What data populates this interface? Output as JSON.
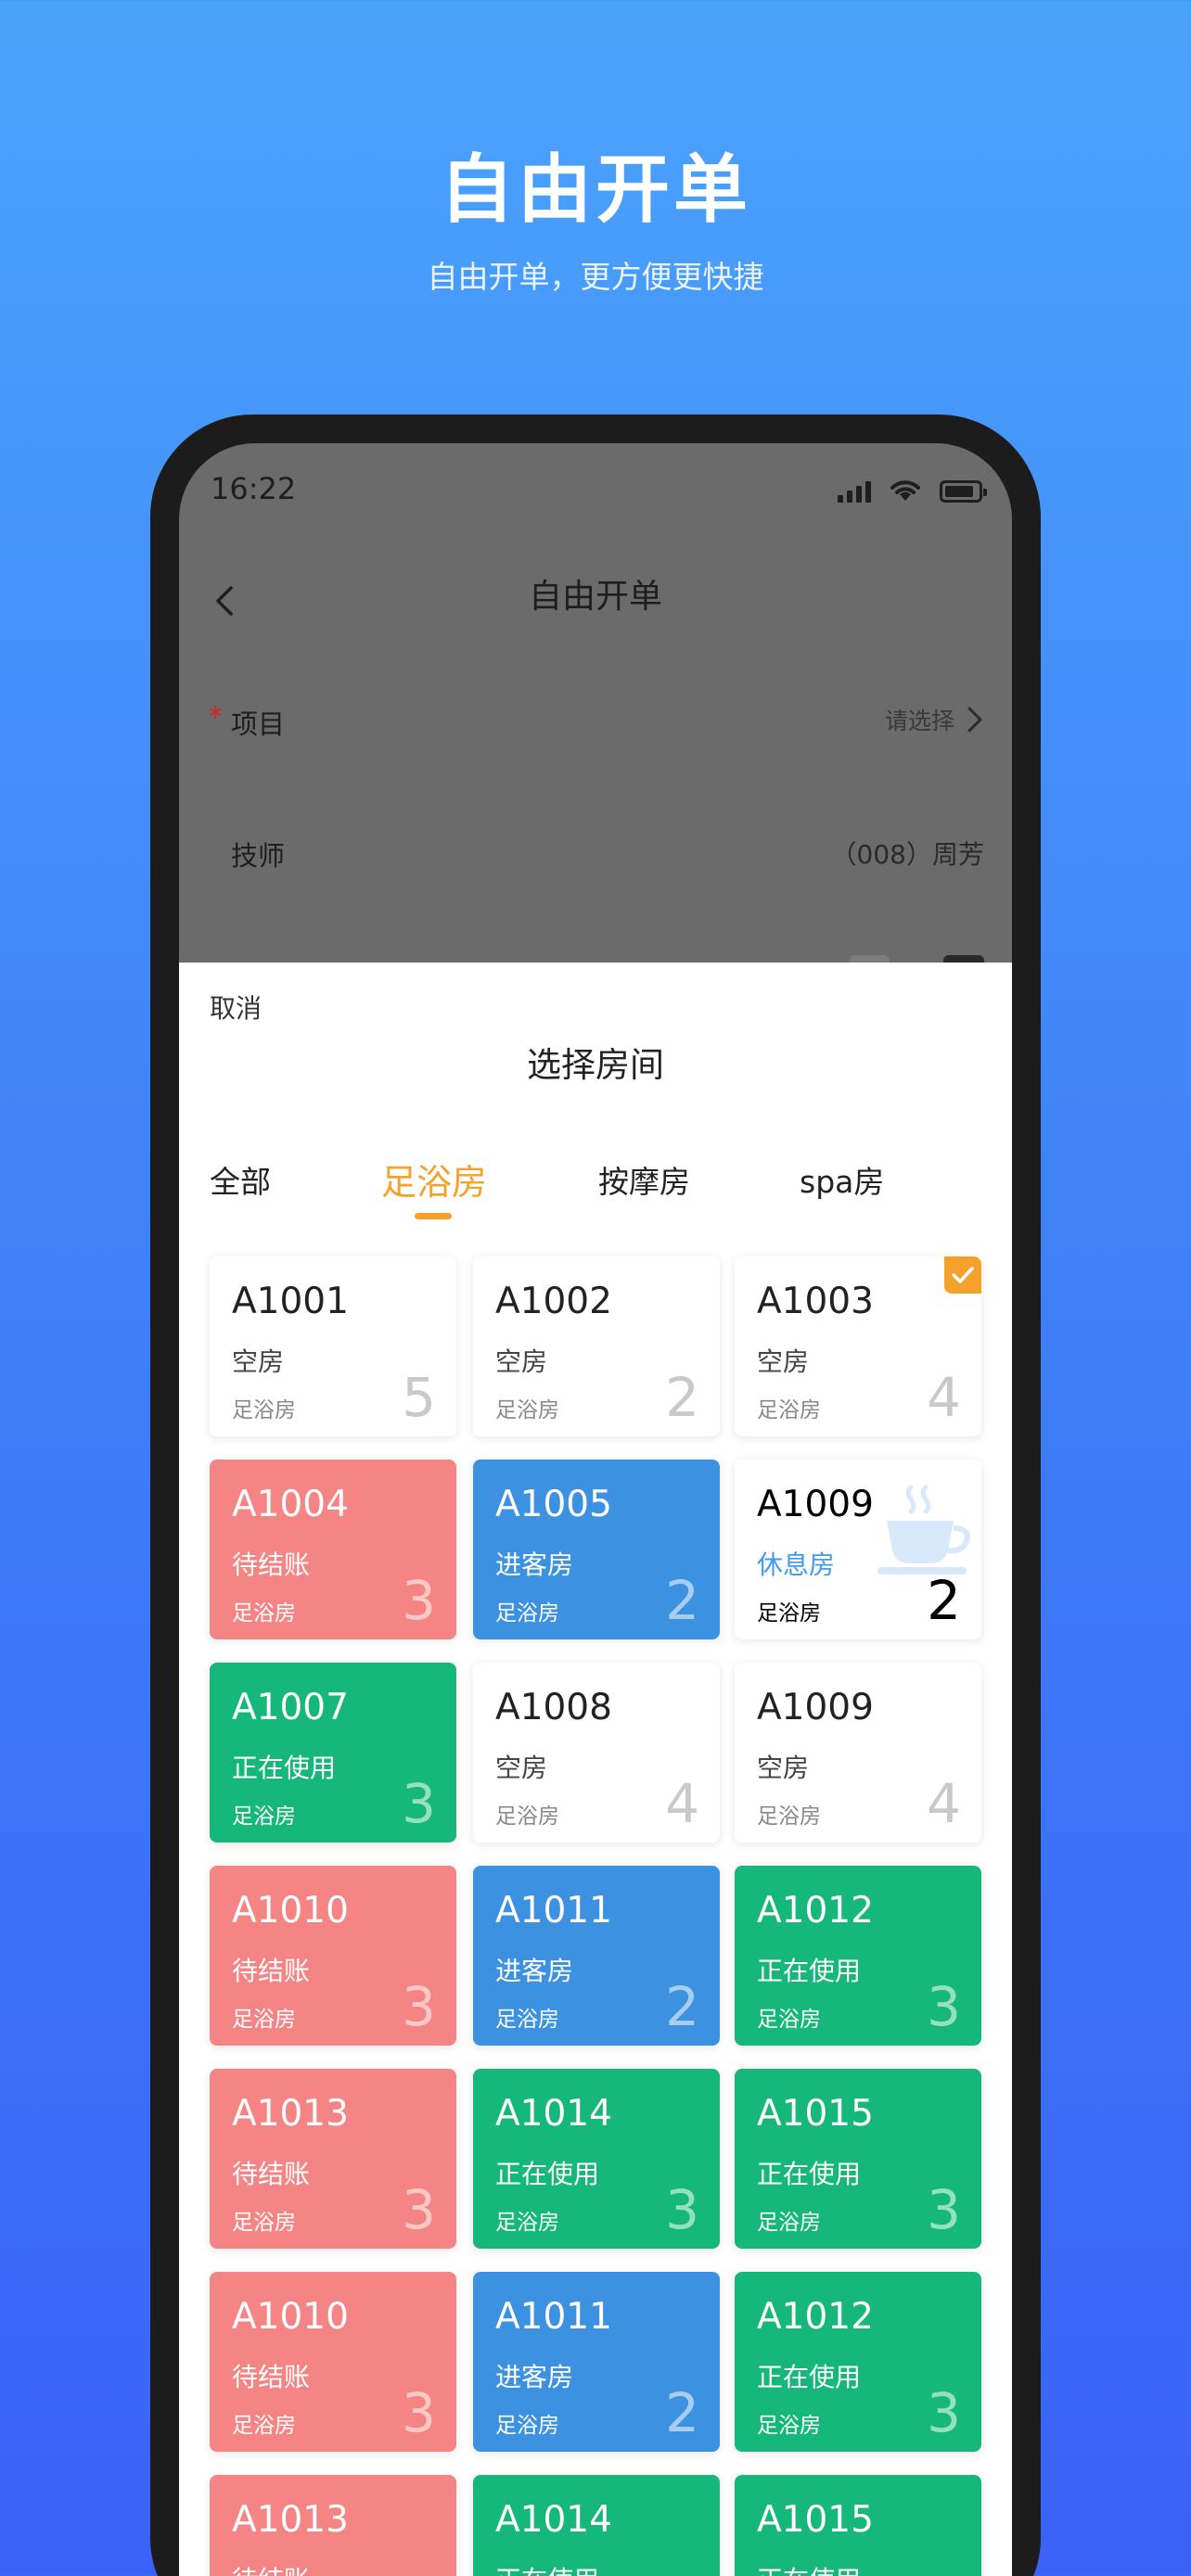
{
  "promo": {
    "title": "自由开单",
    "subtitle": "自由开单，更方便更快捷"
  },
  "status_bar": {
    "time": "16:22",
    "icons": [
      "signal-icon",
      "wifi-icon",
      "battery-icon"
    ]
  },
  "nav": {
    "title": "自由开单",
    "back_icon": "chevron-left-icon"
  },
  "form": {
    "project_label": "项目",
    "project_placeholder": "请选择",
    "technician_label": "技师",
    "technician_value": "（008）周芳"
  },
  "sheet": {
    "cancel_label": "取消",
    "title": "选择房间",
    "tabs": [
      {
        "label": "全部",
        "active": false
      },
      {
        "label": "足浴房",
        "active": true
      },
      {
        "label": "按摩房",
        "active": false
      },
      {
        "label": "spa房",
        "active": false
      }
    ],
    "rooms": [
      {
        "code": "A1001",
        "status": "空房",
        "type": "足浴房",
        "count": "5",
        "state": "empty",
        "selected": false
      },
      {
        "code": "A1002",
        "status": "空房",
        "type": "足浴房",
        "count": "2",
        "state": "empty",
        "selected": false
      },
      {
        "code": "A1003",
        "status": "空房",
        "type": "足浴房",
        "count": "4",
        "state": "empty",
        "selected": true
      },
      {
        "code": "A1004",
        "status": "待结账",
        "type": "足浴房",
        "count": "3",
        "state": "pending",
        "selected": false
      },
      {
        "code": "A1005",
        "status": "进客房",
        "type": "足浴房",
        "count": "2",
        "state": "guest",
        "selected": false
      },
      {
        "code": "A1009",
        "status": "休息房",
        "type": "足浴房",
        "count": "2",
        "state": "rest",
        "selected": false
      },
      {
        "code": "A1007",
        "status": "正在使用",
        "type": "足浴房",
        "count": "3",
        "state": "using",
        "selected": false
      },
      {
        "code": "A1008",
        "status": "空房",
        "type": "足浴房",
        "count": "4",
        "state": "empty",
        "selected": false
      },
      {
        "code": "A1009",
        "status": "空房",
        "type": "足浴房",
        "count": "4",
        "state": "empty",
        "selected": false
      },
      {
        "code": "A1010",
        "status": "待结账",
        "type": "足浴房",
        "count": "3",
        "state": "pending",
        "selected": false
      },
      {
        "code": "A1011",
        "status": "进客房",
        "type": "足浴房",
        "count": "2",
        "state": "guest",
        "selected": false
      },
      {
        "code": "A1012",
        "status": "正在使用",
        "type": "足浴房",
        "count": "3",
        "state": "using",
        "selected": false
      },
      {
        "code": "A1013",
        "status": "待结账",
        "type": "足浴房",
        "count": "3",
        "state": "pending",
        "selected": false
      },
      {
        "code": "A1014",
        "status": "正在使用",
        "type": "足浴房",
        "count": "3",
        "state": "using",
        "selected": false
      },
      {
        "code": "A1015",
        "status": "正在使用",
        "type": "足浴房",
        "count": "3",
        "state": "using",
        "selected": false
      },
      {
        "code": "A1010",
        "status": "待结账",
        "type": "足浴房",
        "count": "3",
        "state": "pending",
        "selected": false
      },
      {
        "code": "A1011",
        "status": "进客房",
        "type": "足浴房",
        "count": "2",
        "state": "guest",
        "selected": false
      },
      {
        "code": "A1012",
        "status": "正在使用",
        "type": "足浴房",
        "count": "3",
        "state": "using",
        "selected": false
      },
      {
        "code": "A1013",
        "status": "待结账",
        "type": "",
        "count": "",
        "state": "pending",
        "selected": false
      },
      {
        "code": "A1014",
        "status": "正在使用",
        "type": "",
        "count": "",
        "state": "using",
        "selected": false
      },
      {
        "code": "A1015",
        "status": "正在使用",
        "type": "",
        "count": "",
        "state": "using",
        "selected": false
      }
    ],
    "colors": {
      "accent": "#f5a22c",
      "pending": "#f58584",
      "guest": "#3c92e0",
      "using": "#15b87a",
      "rest_text": "#3e9bf0"
    }
  }
}
